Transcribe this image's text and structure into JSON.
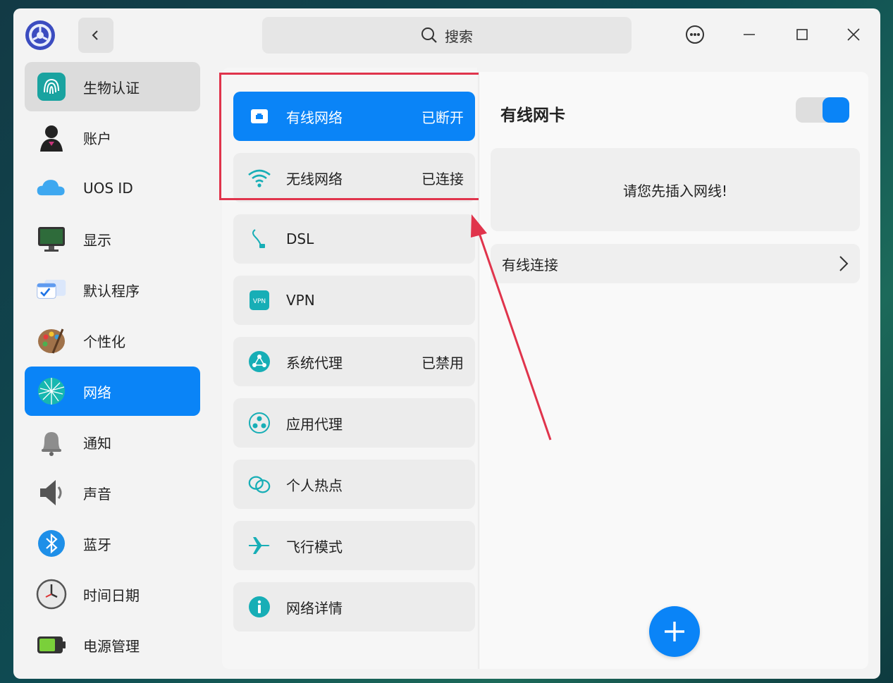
{
  "titlebar": {
    "search_placeholder": "搜索",
    "icons": [
      "app-logo-icon",
      "back-arrow-icon",
      "search-icon",
      "more-options-icon",
      "minimize-icon",
      "maximize-icon",
      "close-icon"
    ]
  },
  "sidebar": {
    "items": [
      {
        "label": "生物认证",
        "icon": "fingerprint-icon",
        "state": "hovered"
      },
      {
        "label": "账户",
        "icon": "account-avatar-icon"
      },
      {
        "label": "UOS ID",
        "icon": "cloud-icon"
      },
      {
        "label": "显示",
        "icon": "display-monitor-icon"
      },
      {
        "label": "默认程序",
        "icon": "default-apps-icon"
      },
      {
        "label": "个性化",
        "icon": "palette-icon"
      },
      {
        "label": "网络",
        "icon": "network-globe-icon",
        "state": "selected"
      },
      {
        "label": "通知",
        "icon": "bell-icon"
      },
      {
        "label": "声音",
        "icon": "speaker-icon"
      },
      {
        "label": "蓝牙",
        "icon": "bluetooth-icon"
      },
      {
        "label": "时间日期",
        "icon": "clock-icon"
      },
      {
        "label": "电源管理",
        "icon": "battery-icon"
      }
    ]
  },
  "network_menu": {
    "items": [
      {
        "label": "有线网络",
        "status": "已断开",
        "icon": "ethernet-icon",
        "state": "selected"
      },
      {
        "label": "无线网络",
        "status": "已连接",
        "icon": "wifi-icon"
      },
      {
        "label": "DSL",
        "status": "",
        "icon": "dsl-cable-icon"
      },
      {
        "label": "VPN",
        "status": "",
        "icon": "vpn-icon"
      },
      {
        "label": "系统代理",
        "status": "已禁用",
        "icon": "system-proxy-icon"
      },
      {
        "label": "应用代理",
        "status": "",
        "icon": "app-proxy-icon"
      },
      {
        "label": "个人热点",
        "status": "",
        "icon": "hotspot-icon"
      },
      {
        "label": "飞行模式",
        "status": "",
        "icon": "airplane-icon"
      },
      {
        "label": "网络详情",
        "status": "",
        "icon": "info-icon"
      }
    ]
  },
  "detail": {
    "title": "有线网卡",
    "toggle_on": true,
    "notice": "请您先插入网线!",
    "connection_label": "有线连接"
  },
  "colors": {
    "accent": "#0a84f7",
    "annotation": "#e0344c"
  }
}
